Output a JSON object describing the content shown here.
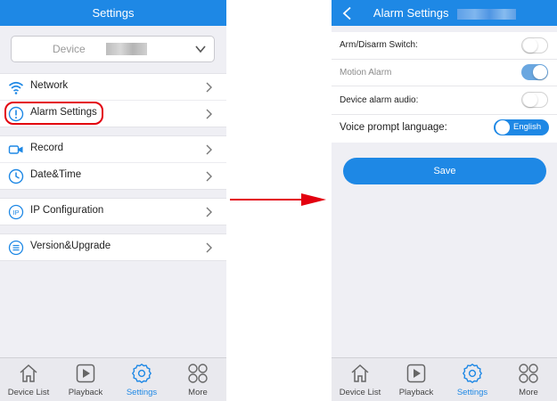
{
  "left_screen": {
    "header_title": "Settings",
    "device_selector_label": "Device",
    "rows": [
      {
        "label": "Network",
        "icon": "wifi-icon"
      },
      {
        "label": "Alarm Settings",
        "icon": "alert-circle-icon"
      },
      {
        "label": "Record",
        "icon": "video-camera-icon"
      },
      {
        "label": "Date&Time",
        "icon": "clock-icon"
      },
      {
        "label": "IP Configuration",
        "icon": "ip-icon"
      },
      {
        "label": "Version&Upgrade",
        "icon": "list-circle-icon"
      }
    ],
    "highlighted_row": "Alarm Settings",
    "highlight_color": "#e3000f"
  },
  "right_screen": {
    "header_title": "Alarm Settings",
    "arm_disarm_label": "Arm/Disarm Switch:",
    "arm_disarm_on": false,
    "motion_alarm_label": "Motion Alarm",
    "motion_alarm_on": true,
    "device_alarm_audio_label": "Device alarm audio:",
    "device_alarm_audio_on": false,
    "voice_prompt_label": "Voice prompt language:",
    "voice_prompt_value": "English",
    "save_label": "Save"
  },
  "tab_bar": {
    "tabs": [
      {
        "label": "Device List",
        "icon": "house-icon"
      },
      {
        "label": "Playback",
        "icon": "play-icon"
      },
      {
        "label": "Settings",
        "icon": "gear-icon"
      },
      {
        "label": "More",
        "icon": "four-circles-icon"
      }
    ],
    "active_tab": "Settings"
  },
  "colors": {
    "accent": "#1e88e5",
    "background": "#efeff4",
    "arrow": "#e3000f",
    "toggle_on": "#6aa7e0",
    "tab_bar": "#e9e9ee"
  }
}
